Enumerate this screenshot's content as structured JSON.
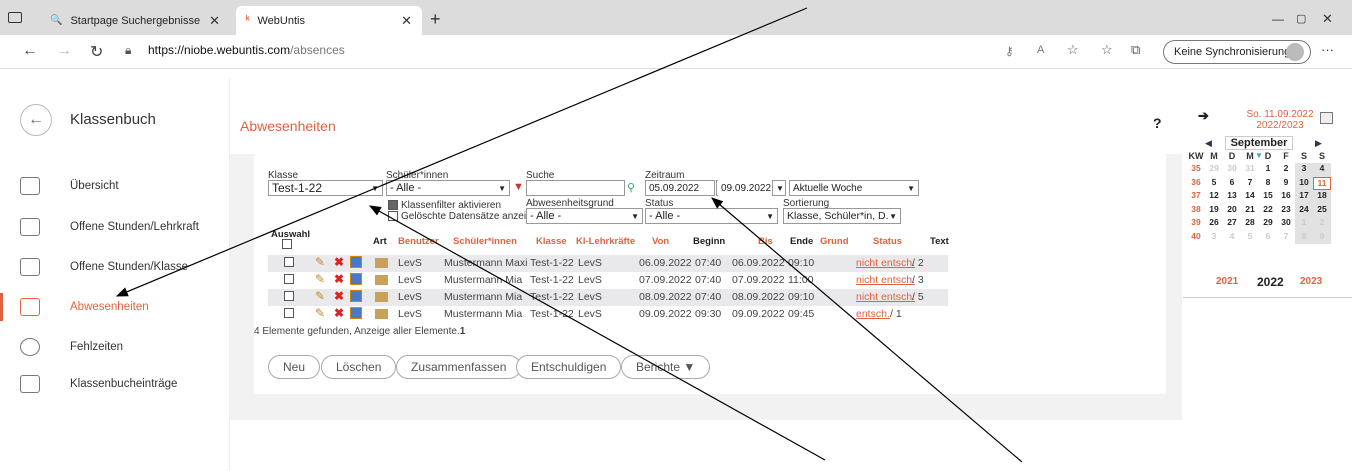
{
  "browser": {
    "tabs": [
      {
        "label": "Startpage Suchergebnisse"
      },
      {
        "label": "WebUntis"
      }
    ],
    "url_host": "https://niobe.webuntis.com",
    "url_path": "/absences",
    "sync_label": "Keine Synchronisierung",
    "new_tab": "+"
  },
  "sidebar": {
    "title": "Klassenbuch",
    "items": [
      {
        "label": "Übersicht"
      },
      {
        "label": "Offene Stunden/Lehrkraft"
      },
      {
        "label": "Offene Stunden/Klasse"
      },
      {
        "label": "Abwesenheiten"
      },
      {
        "label": "Fehlzeiten"
      },
      {
        "label": "Klassenbucheinträge"
      }
    ]
  },
  "page": {
    "title": "Abwesenheiten",
    "help": "?"
  },
  "filters": {
    "klasse_label": "Klasse",
    "klasse_value": "Test-1-22",
    "schueler_label": "Schüler*innen",
    "schueler_value": "- Alle -",
    "suche_label": "Suche",
    "zeitraum_label": "Zeitraum",
    "von": "05.09.2022",
    "bis": "09.09.2022",
    "zeitraum_preset": "Aktuelle Woche",
    "klassenfilter_label": "Klassenfilter aktivieren",
    "geloeschte_label": "Gelöschte Datensätze anzeigen",
    "grund_label": "Abwesenheitsgrund",
    "grund_value": "- Alle -",
    "status_label": "Status",
    "status_value": "- Alle -",
    "sort_label": "Sortierung",
    "sort_value": "Klasse, Schüler*in, D."
  },
  "table": {
    "headers": {
      "auswahl": "Auswahl",
      "art": "Art",
      "benutzer": "Benutzer",
      "schueler": "Schüler*innen",
      "klasse": "Klasse",
      "kl": "Kl-Lehrkräfte",
      "von": "Von",
      "beginn": "Beginn",
      "bis": "Bis",
      "ende": "Ende",
      "grund": "Grund",
      "status": "Status",
      "text": "Text"
    },
    "rows": [
      {
        "benutzer": "LevS",
        "schueler": "Mustermann Maxi",
        "klasse": "Test-1-22",
        "kl": "LevS",
        "von": "06.09.2022",
        "beginn": "07:40",
        "bis": "06.09.2022",
        "ende": "09:10",
        "status": "nicht entsch.",
        "count": "/ 2"
      },
      {
        "benutzer": "LevS",
        "schueler": "Mustermann Mia",
        "klasse": "Test-1-22",
        "kl": "LevS",
        "von": "07.09.2022",
        "beginn": "07:40",
        "bis": "07.09.2022",
        "ende": "11:00",
        "status": "nicht entsch.",
        "count": "/ 3"
      },
      {
        "benutzer": "LevS",
        "schueler": "Mustermann Mia",
        "klasse": "Test-1-22",
        "kl": "LevS",
        "von": "08.09.2022",
        "beginn": "07:40",
        "bis": "08.09.2022",
        "ende": "09:10",
        "status": "nicht entsch.",
        "count": "/ 5"
      },
      {
        "benutzer": "LevS",
        "schueler": "Mustermann Mia",
        "klasse": "Test-1-22",
        "kl": "LevS",
        "von": "09.09.2022",
        "beginn": "09:30",
        "bis": "09.09.2022",
        "ende": "09:45",
        "status": "entsch.",
        "count": "/ 1"
      }
    ],
    "summary": "4 Elemente gefunden, Anzeige aller Elemente.",
    "summary_page": "1"
  },
  "buttons": {
    "neu": "Neu",
    "loeschen": "Löschen",
    "zusammenfassen": "Zusammenfassen",
    "entschuldigen": "Entschuldigen",
    "berichte": "Berichte ▼"
  },
  "calendar": {
    "date_line1": "So. 11.09.2022",
    "date_line2": "2022/2023",
    "month": "September",
    "weekday_headers": [
      "KW",
      "M",
      "D",
      "M",
      "D",
      "F",
      "S",
      "S"
    ],
    "weeks": [
      [
        "35",
        "29",
        "30",
        "31",
        "1",
        "2",
        "3",
        "4"
      ],
      [
        "36",
        "5",
        "6",
        "7",
        "8",
        "9",
        "10",
        "11"
      ],
      [
        "37",
        "12",
        "13",
        "14",
        "15",
        "16",
        "17",
        "18"
      ],
      [
        "38",
        "19",
        "20",
        "21",
        "22",
        "23",
        "24",
        "25"
      ],
      [
        "39",
        "26",
        "27",
        "28",
        "29",
        "30",
        "1",
        "2"
      ],
      [
        "40",
        "3",
        "4",
        "5",
        "6",
        "7",
        "8",
        "9"
      ]
    ],
    "years": [
      "2021",
      "2022",
      "2023"
    ]
  },
  "colors": {
    "accent": "#e0633f"
  }
}
